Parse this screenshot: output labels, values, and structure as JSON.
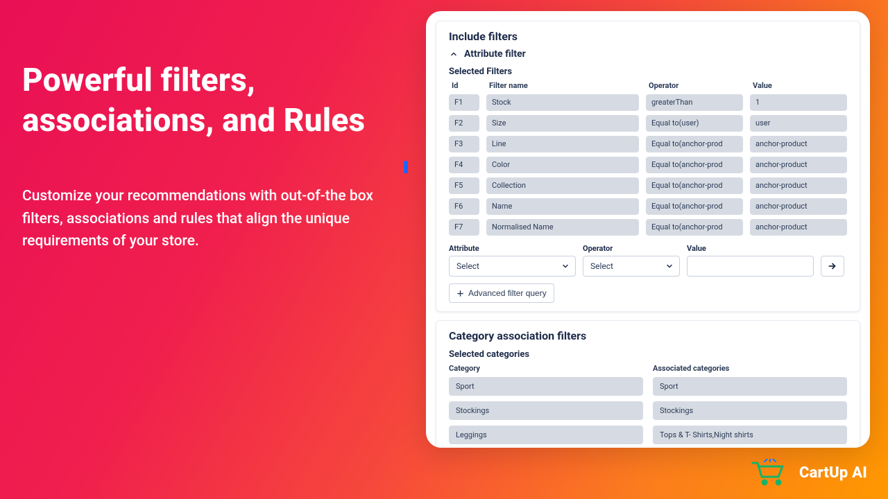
{
  "hero": {
    "title": "Powerful filters, associations, and Rules",
    "subtitle": "Customize your recommendations with out-of-the box filters, associations and rules that align the unique requirements of your store."
  },
  "includeFilters": {
    "title": "Include filters",
    "accordion": "Attribute filter",
    "selectedHeading": "Selected Filters",
    "columns": {
      "id": "Id",
      "name": "Filter name",
      "operator": "Operator",
      "value": "Value"
    },
    "rows": [
      {
        "id": "F1",
        "name": "Stock",
        "operator": "greaterThan",
        "value": "1"
      },
      {
        "id": "F2",
        "name": "Size",
        "operator": "Equal to(user)",
        "value": "user"
      },
      {
        "id": "F3",
        "name": "Line",
        "operator": "Equal to(anchor-prod",
        "value": "anchor-product"
      },
      {
        "id": "F4",
        "name": "Color",
        "operator": "Equal to(anchor-prod",
        "value": "anchor-product"
      },
      {
        "id": "F5",
        "name": "Collection",
        "operator": "Equal to(anchor-prod",
        "value": "anchor-product"
      },
      {
        "id": "F6",
        "name": "Name",
        "operator": "Equal to(anchor-prod",
        "value": "anchor-product"
      },
      {
        "id": "F7",
        "name": "Normalised Name",
        "operator": "Equal to(anchor-prod",
        "value": "anchor-product"
      }
    ],
    "builder": {
      "attributeLabel": "Attribute",
      "attributeValue": "Select",
      "operatorLabel": "Operator",
      "operatorValue": "Select",
      "valueLabel": "Value",
      "valueInput": ""
    },
    "advancedLabel": "Advanced filter query"
  },
  "categoryFilters": {
    "title": "Category association filters",
    "selectedHeading": "Selected categories",
    "columns": {
      "category": "Category",
      "associated": "Associated categories"
    },
    "rows": [
      {
        "category": "Sport",
        "associated": "Sport"
      },
      {
        "category": "Stockings",
        "associated": "Stockings"
      },
      {
        "category": "Leggings",
        "associated": "Tops & T- Shirts,Night shirts"
      }
    ]
  },
  "brand": {
    "name": "CartUp AI"
  }
}
